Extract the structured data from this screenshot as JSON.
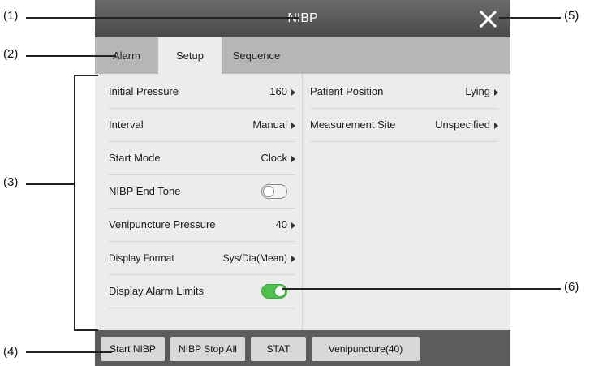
{
  "callouts": [
    "(1)",
    "(2)",
    "(3)",
    "(4)",
    "(5)",
    "(6)"
  ],
  "window": {
    "title": "NIBP"
  },
  "tabs": [
    {
      "label": "Alarm",
      "active": false
    },
    {
      "label": "Setup",
      "active": true
    },
    {
      "label": "Sequence",
      "active": false
    }
  ],
  "left_rows": [
    {
      "label": "Initial Pressure",
      "value": "160"
    },
    {
      "label": "Interval",
      "value": "Manual"
    },
    {
      "label": "Start Mode",
      "value": "Clock"
    },
    {
      "label": "NIBP End Tone",
      "toggle": "off"
    },
    {
      "label": "Venipuncture Pressure",
      "value": "40"
    },
    {
      "label": "Display Format",
      "value": "Sys/Dia(Mean)"
    },
    {
      "label": "Display Alarm Limits",
      "toggle": "on"
    }
  ],
  "right_rows": [
    {
      "label": "Patient Position",
      "value": "Lying"
    },
    {
      "label": "Measurement Site",
      "value": "Unspecified"
    }
  ],
  "bottom_buttons": [
    {
      "label": "Start NIBP"
    },
    {
      "label": "NIBP Stop All"
    },
    {
      "label": "STAT"
    },
    {
      "label": "Venipuncture(40)"
    }
  ],
  "colors": {
    "title_bar": "#555555",
    "tab_bar": "#b6b6b6",
    "panel": "#ececec",
    "bottom_bar": "#5c5c5c",
    "toggle_on": "#4cc24c"
  }
}
